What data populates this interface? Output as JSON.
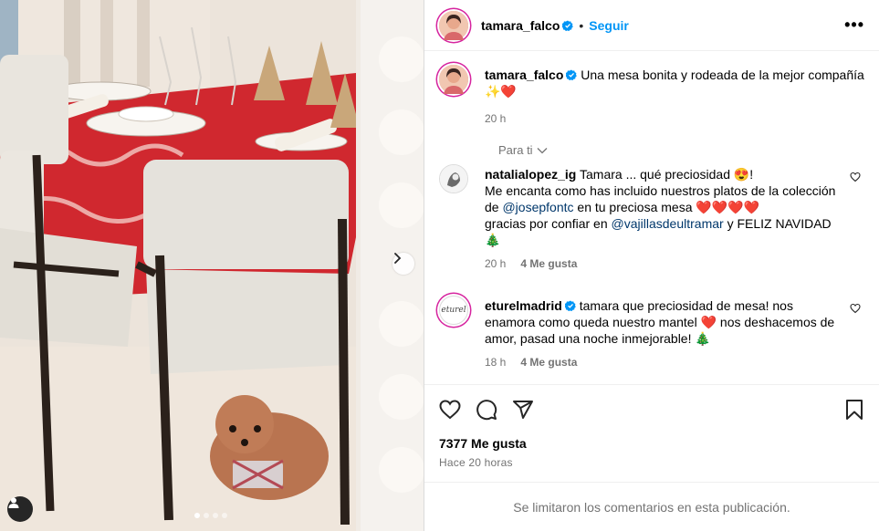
{
  "post": {
    "author": "tamara_falco",
    "follow_label": "Seguir",
    "more_label": "•••",
    "caption": {
      "username": "tamara_falco",
      "text": "Una mesa bonita y rodeada de la mejor compañía ✨❤️",
      "time": "20 h"
    },
    "filter_label": "Para ti"
  },
  "comments": [
    {
      "username": "natalialopez_ig",
      "text_1": "Tamara ... qué preciosidad 😍!",
      "text_2": "Me encanta como has incluido nuestros platos de la colección de ",
      "mention_1": "@josepfontc",
      "text_3": " en tu preciosa mesa ❤️❤️❤️❤️",
      "text_4": "gracias por confiar en ",
      "mention_2": "@vajillasdeultramar",
      "text_5": " y FELIZ NAVIDAD 🎄",
      "time": "20 h",
      "likes": "4 Me gusta"
    },
    {
      "username": "eturelmadrid",
      "avatar_text": "eturel",
      "text": "tamara que preciosidad de mesa! nos enamora como queda nuestro mantel ❤️ nos deshacemos de amor, pasad una noche inmejorable! 🎄",
      "time": "18 h",
      "likes": "4 Me gusta"
    }
  ],
  "stats": {
    "likes": "7377 Me gusta",
    "time": "Hace 20 horas"
  },
  "footer": {
    "limited_text": "Se limitaron los comentarios en esta publicación."
  },
  "icons": {
    "verified": "verified-badge-icon",
    "like": "heart-icon",
    "comment": "comment-icon",
    "share": "share-icon",
    "save": "bookmark-icon",
    "next": "chevron-right-icon",
    "tag": "user-tag-icon"
  },
  "colors": {
    "accent": "#0095f6",
    "verified": "#0095f6",
    "secondary_text": "#737373",
    "mention": "#00376b"
  },
  "carousel": {
    "count": 4,
    "active": 1
  }
}
